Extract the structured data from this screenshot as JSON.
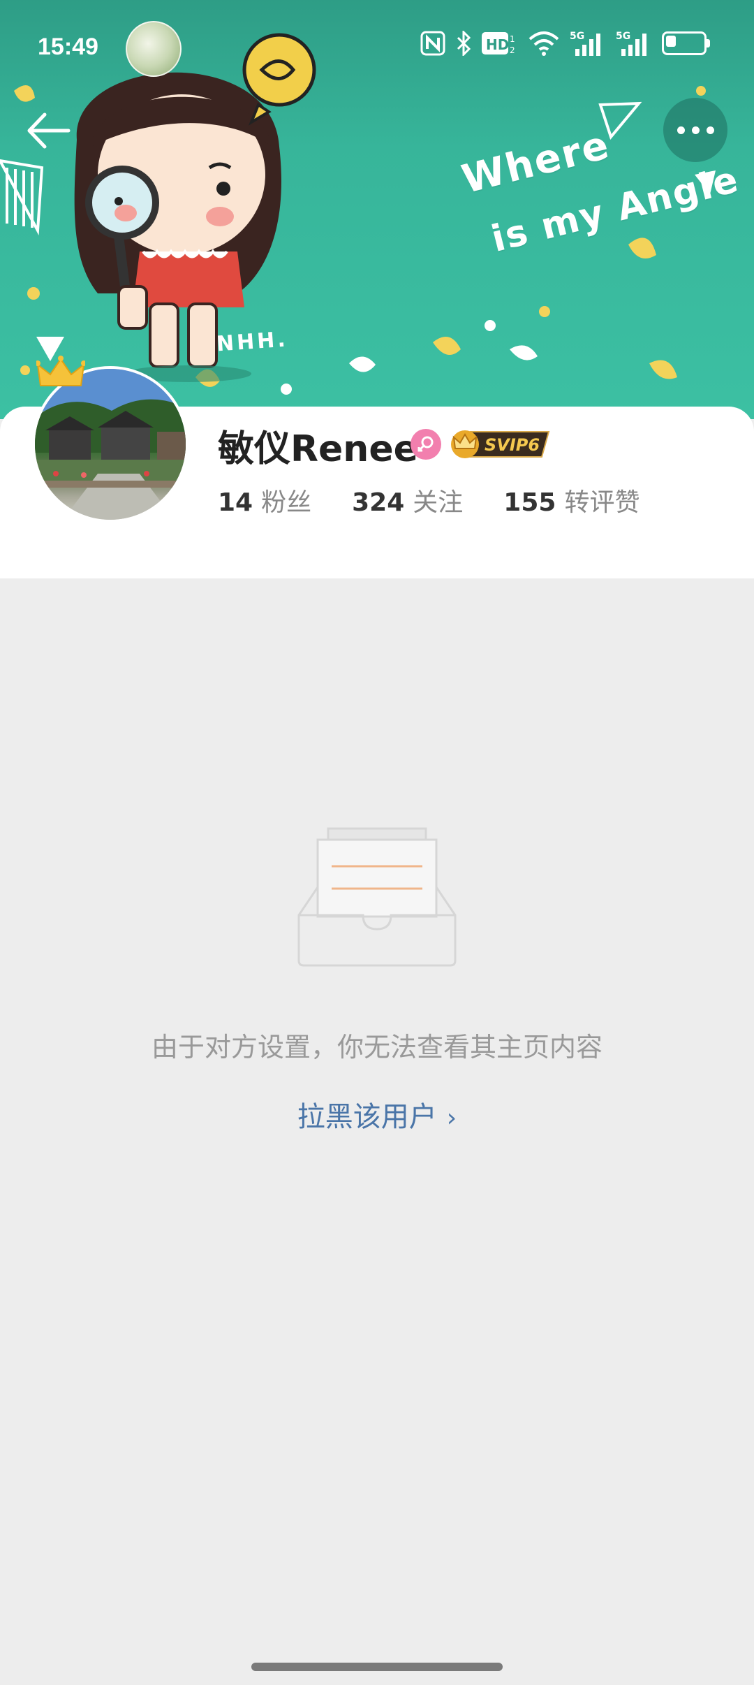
{
  "status_bar": {
    "time": "15:49",
    "icons": [
      "nfc-icon",
      "bluetooth-icon",
      "hd-icon",
      "wifi-icon",
      "signal-5g-1-icon",
      "signal-5g-2-icon",
      "battery-icon"
    ]
  },
  "banner": {
    "slogan_line1": "Where",
    "slogan_line2": "is my Angle",
    "signature": "NHH."
  },
  "profile": {
    "name": "敏仪Renee",
    "gender": "female",
    "vip_label": "SVIP6",
    "stats": [
      {
        "value": "14",
        "label": "粉丝"
      },
      {
        "value": "324",
        "label": "关注"
      },
      {
        "value": "155",
        "label": "转评赞"
      }
    ]
  },
  "empty_state": {
    "message": "由于对方设置，你无法查看其主页内容",
    "action_label": "拉黑该用户",
    "action_chevron": "›"
  },
  "colors": {
    "banner": "#37b59a",
    "link": "#4a75a8",
    "page_bg": "#ededed"
  }
}
